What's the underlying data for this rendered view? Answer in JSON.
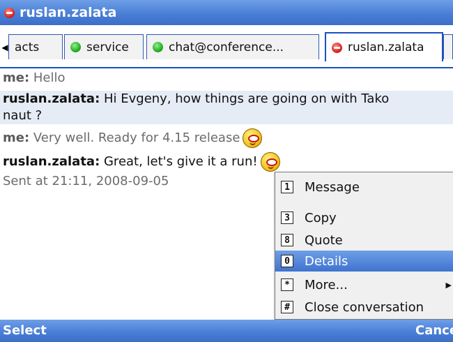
{
  "window": {
    "title": "ruslan.zalata",
    "title_status": "dnd"
  },
  "tabs": [
    {
      "label": "acts",
      "status": "none"
    },
    {
      "label": "service",
      "status": "online"
    },
    {
      "label": "chat@conference...",
      "status": "online"
    },
    {
      "label": "ruslan.zalata",
      "status": "dnd",
      "active": true
    }
  ],
  "messages": [
    {
      "sender": "me:",
      "text": " Hello"
    },
    {
      "sender": "ruslan.zalata:",
      "text": " Hi Evgeny, how things are going on with Tako"
    },
    {
      "sender": "",
      "text": "naut ?"
    },
    {
      "sender": "me:",
      "text": " Very well. Ready for 4.15 release",
      "emoticon": "smile-emoticon"
    },
    {
      "sender": "ruslan.zalata:",
      "text": " Great, let's give it a run!",
      "emoticon": "wink-emoticon"
    },
    {
      "sender": "",
      "text": "Sent at 21:11, 2008-09-05"
    }
  ],
  "menu": {
    "items": [
      {
        "key": "1",
        "label": "Message"
      },
      {
        "key": "3",
        "label": "Copy"
      },
      {
        "key": "8",
        "label": "Quote"
      },
      {
        "key": "0",
        "label": "Details",
        "selected": true
      },
      {
        "key": "*",
        "label": "More...",
        "submenu": true
      },
      {
        "key": "#",
        "label": "Close conversation"
      }
    ]
  },
  "softkeys": {
    "left": "Select",
    "right": "Cance"
  },
  "colors": {
    "bar_blue": "#4a7fd6",
    "tab_border": "#1b50c0",
    "dnd_red": "#d31919",
    "online_green": "#15a315"
  }
}
